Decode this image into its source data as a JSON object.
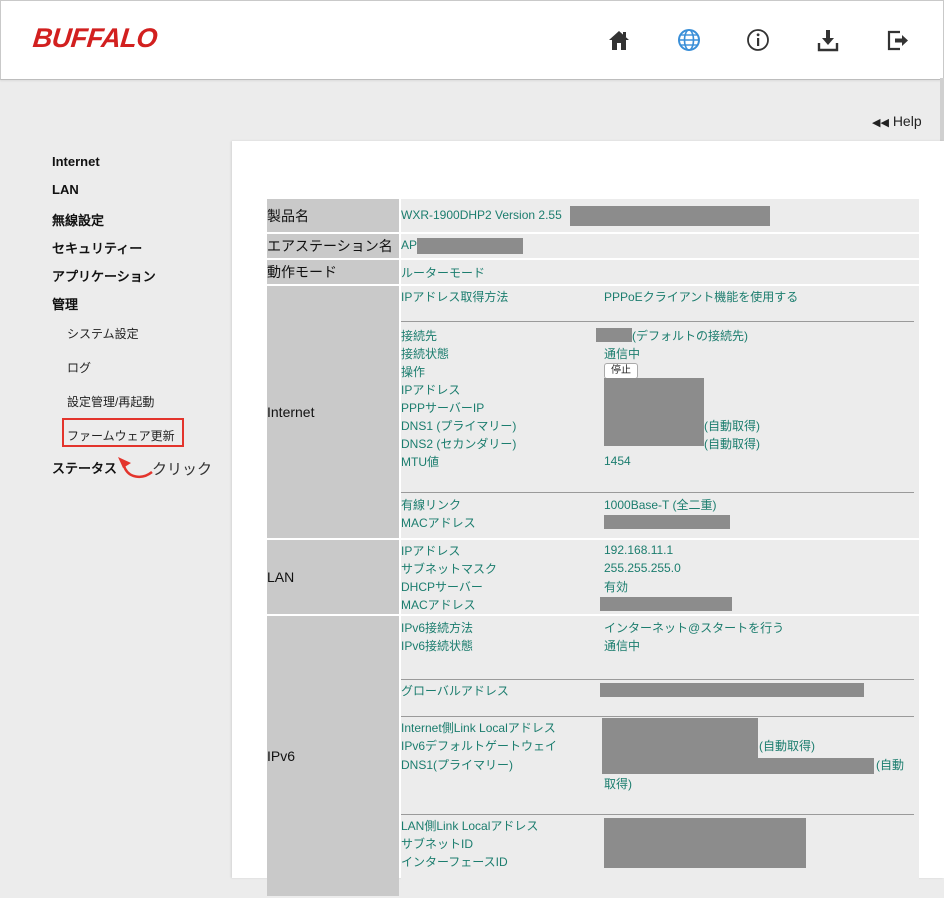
{
  "header": {
    "logo": "BUFFALO",
    "icons": [
      "home-icon",
      "globe-icon",
      "info-icon",
      "download-icon",
      "logout-icon"
    ],
    "accent_color": "#d2201f",
    "active_icon_color": "#3a8fd8"
  },
  "help": {
    "label": "Help",
    "glyph": "◀◀"
  },
  "sidebar": {
    "items": [
      {
        "label": "Internet"
      },
      {
        "label": "LAN"
      },
      {
        "label": "無線設定"
      },
      {
        "label": "セキュリティー"
      },
      {
        "label": "アプリケーション"
      },
      {
        "label": "管理"
      }
    ],
    "subitems": [
      {
        "label": "システム設定"
      },
      {
        "label": "ログ"
      },
      {
        "label": "設定管理/再起動"
      },
      {
        "label": "ファームウェア更新"
      }
    ],
    "status_label": "ステータス",
    "annotation": "クリック"
  },
  "info": {
    "product": {
      "label": "製品名",
      "value": "WXR-1900DHP2  Version 2.55"
    },
    "station": {
      "label": "エアステーション名",
      "value": "AP"
    },
    "mode": {
      "label": "動作モード",
      "value": "ルーターモード"
    },
    "internet": {
      "label": "Internet",
      "acq_label": "IPアドレス取得方法",
      "acq_value": "PPPoEクライアント機能を使用する",
      "dest_label": "接続先",
      "dest_value": "(デフォルトの接続先)",
      "state_label": "接続状態",
      "state_value": "通信中",
      "op_label": "操作",
      "op_button": "停止",
      "ip_label": "IPアドレス",
      "ppp_label": "PPPサーバーIP",
      "dns1_label": "DNS1 (プライマリー)",
      "dns1_suffix": "(自動取得)",
      "dns2_label": "DNS2 (セカンダリー)",
      "dns2_suffix": "(自動取得)",
      "mtu_label": "MTU値",
      "mtu_value": "1454",
      "link_label": "有線リンク",
      "link_value": "1000Base-T (全二重)",
      "mac_label": "MACアドレス"
    },
    "lan": {
      "label": "LAN",
      "ip_label": "IPアドレス",
      "ip_value": "192.168.11.1",
      "mask_label": "サブネットマスク",
      "mask_value": "255.255.255.0",
      "dhcp_label": "DHCPサーバー",
      "dhcp_value": "有効",
      "mac_label": "MACアドレス"
    },
    "ipv6": {
      "label": "IPv6",
      "method_label": "IPv6接続方法",
      "method_value": "インターネット@スタートを行う",
      "state_label": "IPv6接続状態",
      "state_value": "通信中",
      "global_label": "グローバルアドレス",
      "link_local_label": "Internet側Link Localアドレス",
      "gw_label": "IPv6デフォルトゲートウェイ",
      "gw_suffix": "(自動取得)",
      "dns1_label": "DNS1(プライマリー)",
      "dns1_suffix_a": "(自動",
      "dns1_suffix_b": "取得)",
      "lan_link_label": "LAN側Link Localアドレス",
      "subnet_label": "サブネットID",
      "iface_label": "インターフェースID"
    }
  }
}
